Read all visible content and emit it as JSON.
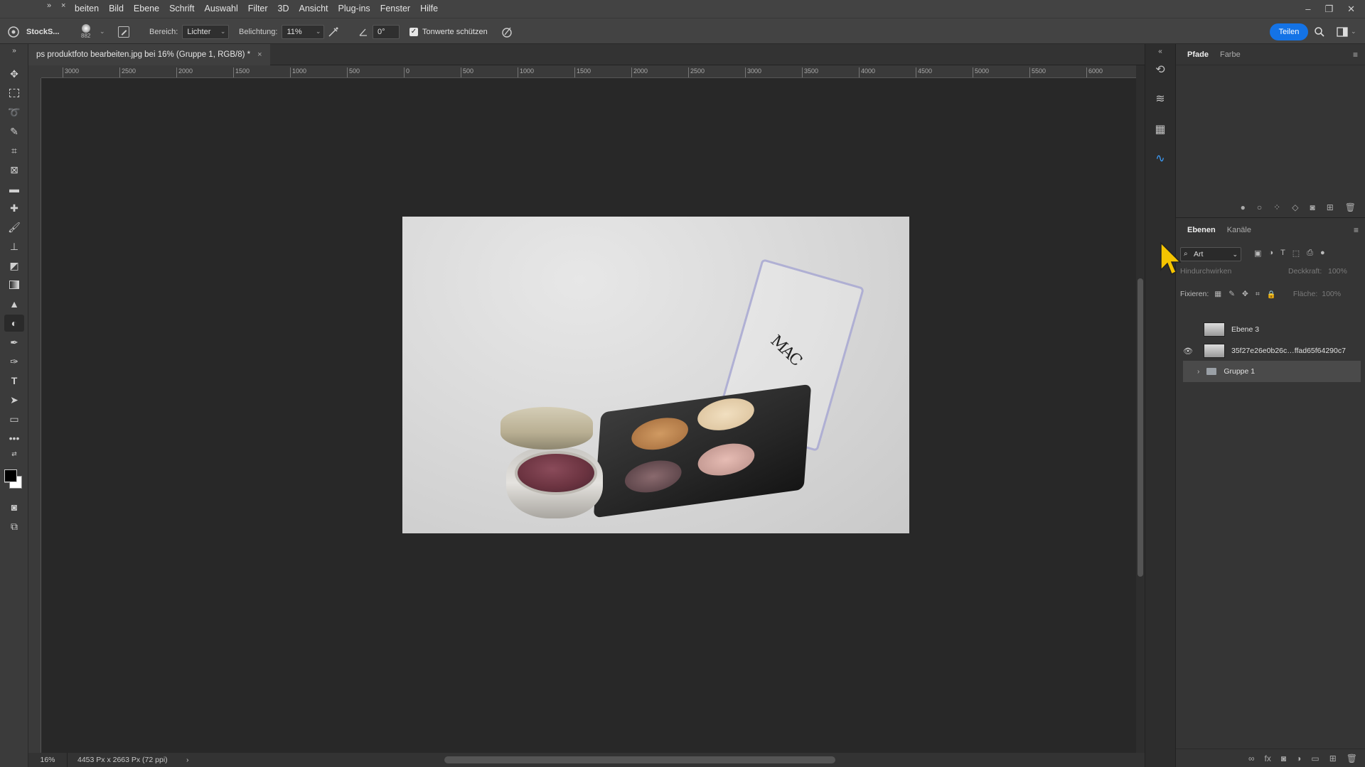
{
  "menubar": {
    "items": [
      "beiten",
      "Bild",
      "Ebene",
      "Schrift",
      "Auswahl",
      "Filter",
      "3D",
      "Ansicht",
      "Plug-ins",
      "Fenster",
      "Hilfe"
    ],
    "collapse_glyph": "»",
    "close_glyph": "×"
  },
  "window_controls": {
    "minimize": "–",
    "restore": "❐",
    "close": "✕"
  },
  "options": {
    "app_label": "StockS...",
    "brush_size": "882",
    "bereich_label": "Bereich:",
    "bereich_value": "Lichter",
    "belichtung_label": "Belichtung:",
    "belichtung_value": "11%",
    "angle_value": "0°",
    "protect_tones_label": "Tonwerte schützen",
    "share_label": "Teilen"
  },
  "document": {
    "tab_title": "ps produktfoto bearbeiten.jpg bei 16% (Gruppe 1, RGB/8) *",
    "tab_close": "×",
    "ruler_ticks": [
      "3000",
      "2500",
      "2000",
      "1500",
      "1000",
      "500",
      "0",
      "500",
      "1000",
      "1500",
      "2000",
      "2500",
      "3000",
      "3500",
      "4000",
      "4500",
      "5000",
      "5500",
      "6000"
    ],
    "zoom": "16%",
    "dimensions": "4453 Px x 2663 Px (72 ppi)",
    "status_arrow": "›",
    "photo_logo": "MAC"
  },
  "right_panel": {
    "top_tabs": [
      "Pfade",
      "Farbe"
    ],
    "layers_tabs": [
      "Ebenen",
      "Kanäle"
    ],
    "filter_value": "Art",
    "blend_mode": "Hindurchwirken",
    "opacity_label": "Deckkraft:",
    "opacity_value": "100%",
    "lock_label": "Fixieren:",
    "fill_label": "Fläche:",
    "fill_value": "100%",
    "layers": [
      {
        "name": "Ebene 3",
        "visible": false,
        "type": "layer"
      },
      {
        "name": "35f27e26e0b26c…ffad65f64290c7",
        "visible": true,
        "type": "layer"
      },
      {
        "name": "Gruppe 1",
        "visible": false,
        "type": "group",
        "selected": true
      }
    ]
  },
  "colors": {
    "accent": "#1473e6",
    "cursor": "#f5c400",
    "foreground": "#000000",
    "background": "#ffffff"
  }
}
